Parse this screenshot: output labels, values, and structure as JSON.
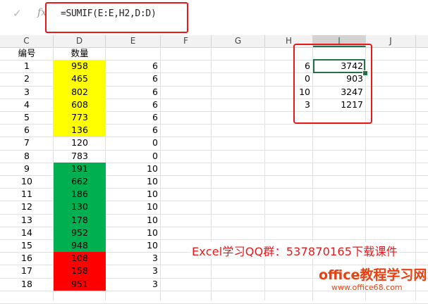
{
  "formula_bar": {
    "confirm_icon": "check-icon",
    "function_icon": "fx-icon",
    "fx_label": "fx",
    "formula": "=SUMIF(E:E,H2,D:D)"
  },
  "columns": [
    "C",
    "D",
    "E",
    "F",
    "G",
    "H",
    "I",
    "J"
  ],
  "selected_column": "I",
  "headers": {
    "c": "编号",
    "d": "数量"
  },
  "rows": [
    {
      "c": "1",
      "d": "958",
      "e": "6",
      "fill": "yellow"
    },
    {
      "c": "2",
      "d": "465",
      "e": "6",
      "fill": "yellow"
    },
    {
      "c": "3",
      "d": "802",
      "e": "6",
      "fill": "yellow"
    },
    {
      "c": "4",
      "d": "608",
      "e": "6",
      "fill": "yellow"
    },
    {
      "c": "5",
      "d": "773",
      "e": "6",
      "fill": "yellow"
    },
    {
      "c": "6",
      "d": "136",
      "e": "6",
      "fill": "yellow"
    },
    {
      "c": "7",
      "d": "120",
      "e": "0",
      "fill": "none"
    },
    {
      "c": "8",
      "d": "783",
      "e": "0",
      "fill": "none"
    },
    {
      "c": "9",
      "d": "191",
      "e": "10",
      "fill": "green"
    },
    {
      "c": "10",
      "d": "662",
      "e": "10",
      "fill": "green"
    },
    {
      "c": "11",
      "d": "186",
      "e": "10",
      "fill": "green"
    },
    {
      "c": "12",
      "d": "130",
      "e": "10",
      "fill": "green"
    },
    {
      "c": "13",
      "d": "178",
      "e": "10",
      "fill": "green"
    },
    {
      "c": "14",
      "d": "952",
      "e": "10",
      "fill": "green"
    },
    {
      "c": "15",
      "d": "948",
      "e": "10",
      "fill": "green"
    },
    {
      "c": "16",
      "d": "108",
      "e": "3",
      "fill": "red"
    },
    {
      "c": "17",
      "d": "158",
      "e": "3",
      "fill": "red"
    },
    {
      "c": "18",
      "d": "951",
      "e": "3",
      "fill": "red"
    }
  ],
  "summary": [
    {
      "h": "6",
      "i": "3742"
    },
    {
      "h": "0",
      "i": "903"
    },
    {
      "h": "10",
      "i": "3247"
    },
    {
      "h": "3",
      "i": "1217"
    }
  ],
  "colors": {
    "yellow": "#ffff00",
    "green": "#00b050",
    "red": "#ff0000",
    "accent": "#217346",
    "annotation": "#e8171a"
  },
  "watermark": {
    "line1": "Excel学习QQ群：537870165下载课件",
    "line2": "office教程学习网",
    "line3": "www.office68.com"
  }
}
